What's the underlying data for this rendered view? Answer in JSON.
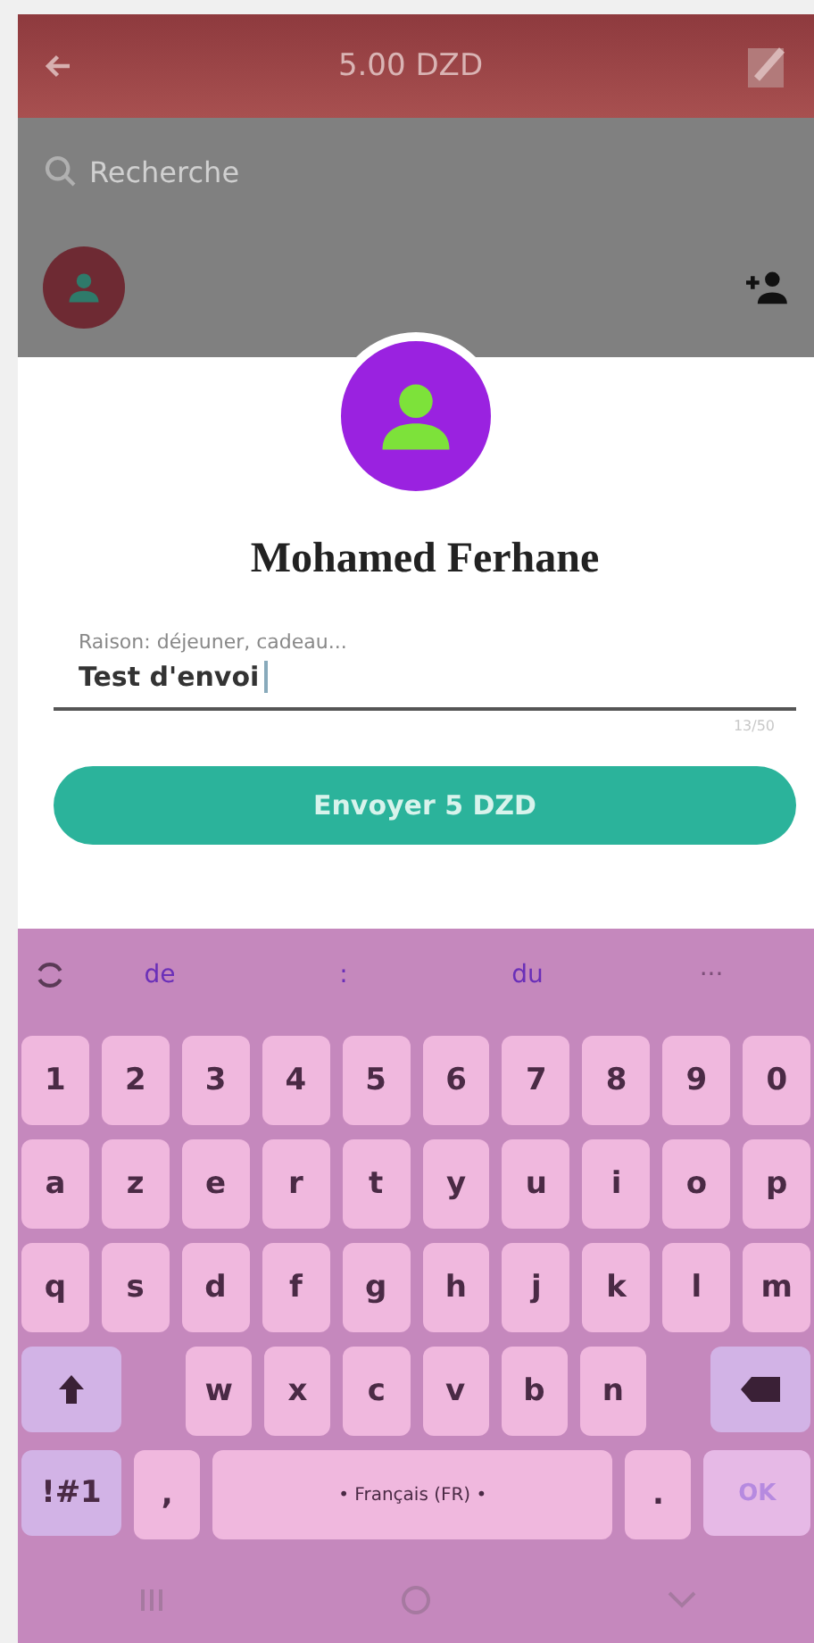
{
  "header": {
    "title": "5.00 DZD"
  },
  "search": {
    "placeholder": "Recherche"
  },
  "sheet": {
    "name": "Mohamed Ferhane",
    "reason": {
      "placeholder": "Raison: déjeuner, cadeau...",
      "value": "Test d'envoi",
      "counter": "13/50"
    },
    "send_button": "Envoyer 5 DZD"
  },
  "keyboard": {
    "suggestions": [
      {
        "text": "de",
        "dimmed": false
      },
      {
        "text": ":",
        "dimmed": false
      },
      {
        "text": "du",
        "dimmed": false
      },
      {
        "text": "···",
        "dimmed": true
      }
    ],
    "rows": [
      [
        "1",
        "2",
        "3",
        "4",
        "5",
        "6",
        "7",
        "8",
        "9",
        "0"
      ],
      [
        "a",
        "z",
        "e",
        "r",
        "t",
        "y",
        "u",
        "i",
        "o",
        "p"
      ],
      [
        "q",
        "s",
        "d",
        "f",
        "g",
        "h",
        "j",
        "k",
        "l",
        "m"
      ]
    ],
    "bottom_letters": [
      "w",
      "x",
      "c",
      "v",
      "b",
      "n"
    ],
    "symbols_key": "!#1",
    "comma_key": ",",
    "space_key": "• Français (FR) •",
    "period_key": ".",
    "ok_key": "OK"
  }
}
